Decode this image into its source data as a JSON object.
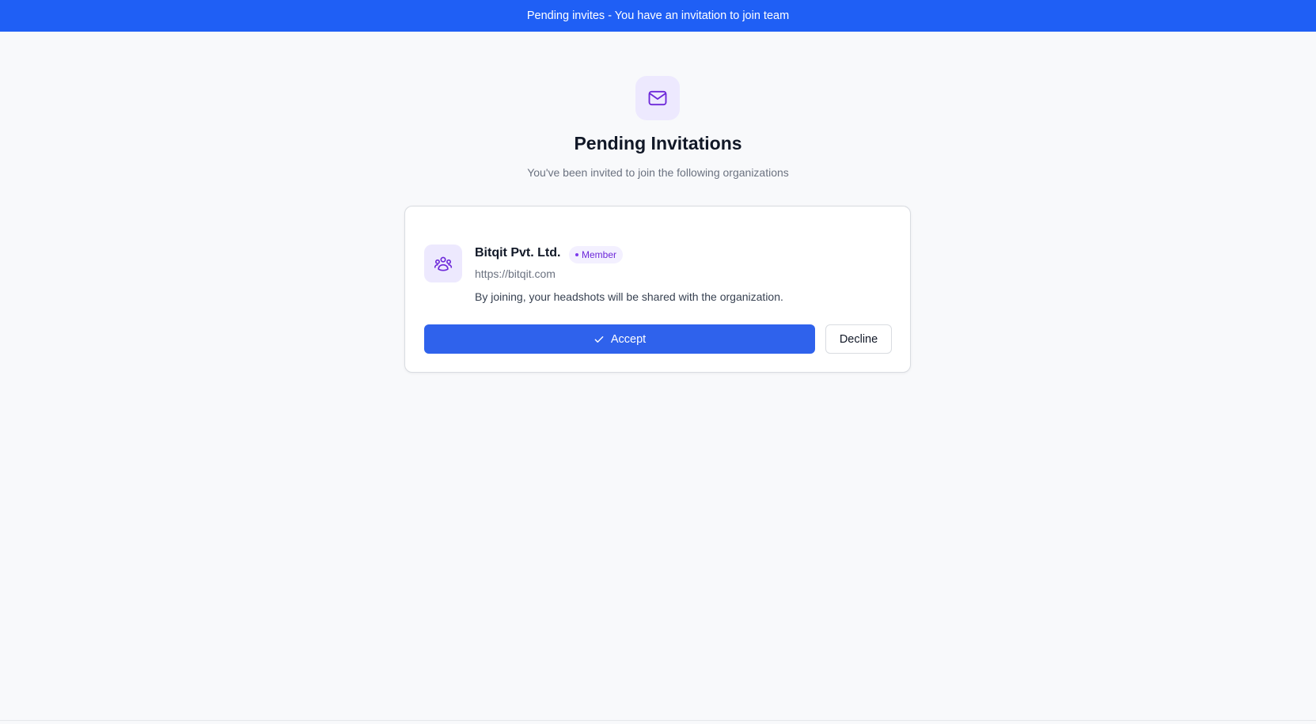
{
  "banner": {
    "text": "Pending invites - You have an invitation to join team"
  },
  "header": {
    "icon": "mail-icon",
    "title": "Pending Invitations",
    "subtitle": "You've been invited to join the following organizations"
  },
  "invitations": [
    {
      "org_name": "Bitqit Pvt. Ltd.",
      "role": "Member",
      "url": "https://bitqit.com",
      "description": "By joining, your headshots will be shared with the organization.",
      "icon": "users-icon",
      "accept_label": "Accept",
      "decline_label": "Decline"
    }
  ],
  "colors": {
    "banner": "#1f5ff5",
    "primary_button": "#2f62ec",
    "accent_purple": "#7c3aed",
    "icon_bg": "#ede9fe",
    "page_bg": "#f8f9fb"
  }
}
